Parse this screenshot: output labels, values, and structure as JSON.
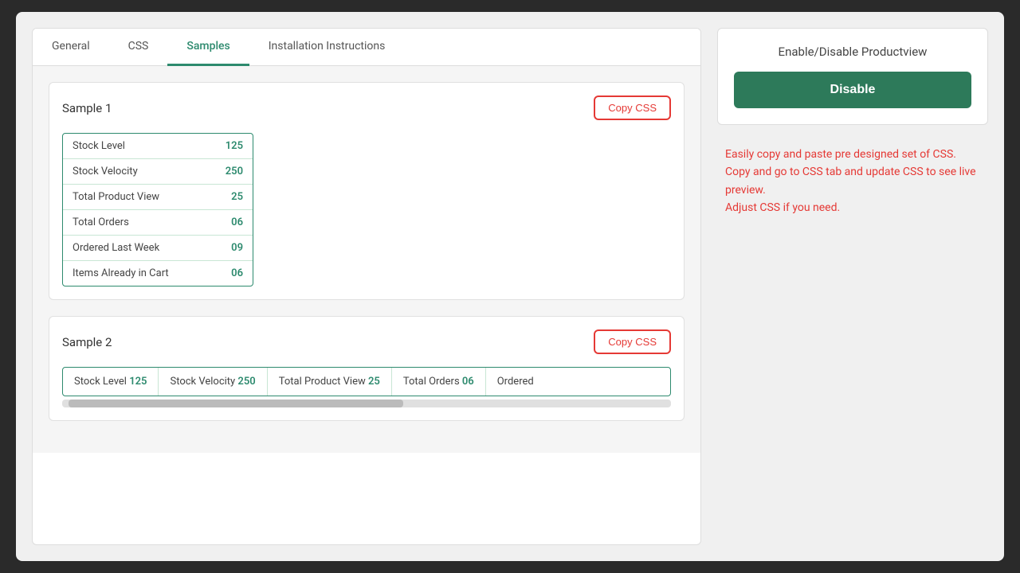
{
  "tabs": [
    {
      "label": "General",
      "active": false
    },
    {
      "label": "CSS",
      "active": false
    },
    {
      "label": "Samples",
      "active": true
    },
    {
      "label": "Installation Instructions",
      "active": false
    }
  ],
  "sample1": {
    "title": "Sample 1",
    "copy_button": "Copy CSS",
    "rows": [
      {
        "label": "Stock Level",
        "value": "125"
      },
      {
        "label": "Stock Velocity",
        "value": "250"
      },
      {
        "label": "Total Product View",
        "value": "25"
      },
      {
        "label": "Total Orders",
        "value": "06"
      },
      {
        "label": "Ordered Last Week",
        "value": "09"
      },
      {
        "label": "Items Already in Cart",
        "value": "06"
      }
    ]
  },
  "sample2": {
    "title": "Sample 2",
    "copy_button": "Copy CSS",
    "cells": [
      {
        "label": "Stock Level",
        "value": "125"
      },
      {
        "label": "Stock Velocity",
        "value": "250"
      },
      {
        "label": "Total Product View",
        "value": "25"
      },
      {
        "label": "Total Orders",
        "value": "06"
      },
      {
        "label": "Ordered",
        "value": ""
      }
    ]
  },
  "right_panel": {
    "title": "Enable/Disable Productview",
    "disable_button": "Disable",
    "callout": "Easily copy and paste pre designed set of CSS.\nCopy and go to CSS tab and update CSS to see live preview.\nAdjust CSS if you need."
  }
}
